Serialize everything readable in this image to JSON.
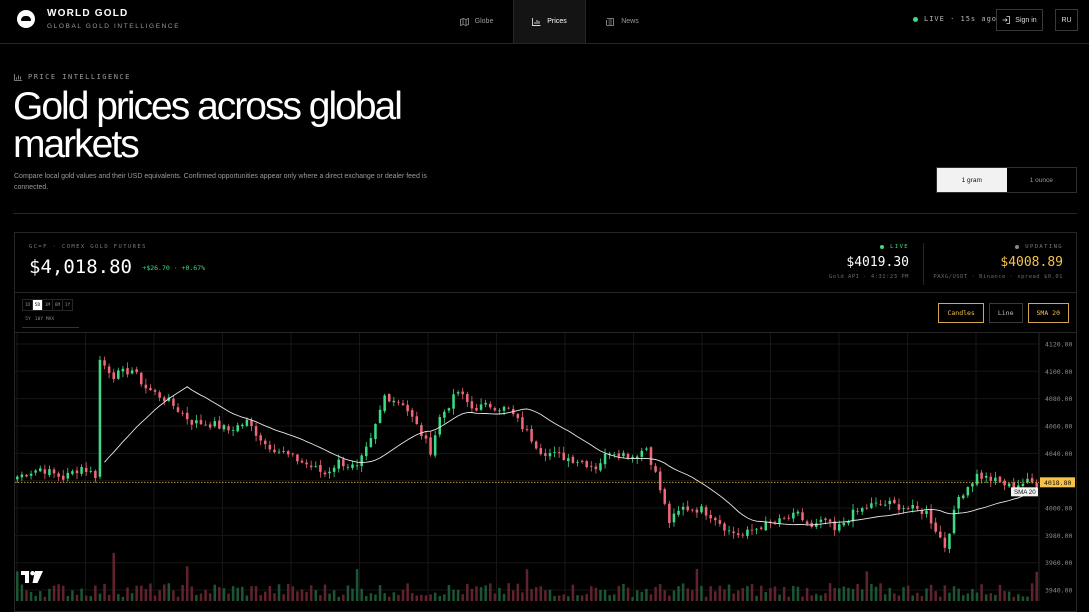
{
  "header": {
    "brand_title": "WORLD GOLD",
    "brand_subtitle": "GLOBAL GOLD INTELLIGENCE",
    "nav": [
      {
        "label": "Globe",
        "icon": "map-icon",
        "active": false
      },
      {
        "label": "Prices",
        "icon": "bar-chart-icon",
        "active": true
      },
      {
        "label": "News",
        "icon": "newspaper-icon",
        "active": false
      }
    ],
    "live_status": "LIVE · 15s ago",
    "sign_in": "Sign in",
    "language": "RU"
  },
  "hero": {
    "eyebrow": "PRICE INTELLIGENCE",
    "title": "Gold prices across global markets",
    "description": "Compare local gold values and their USD equivalents. Confirmed opportunities appear only where a direct exchange or dealer feed is connected.",
    "units": [
      {
        "label": "1 gram",
        "active": true
      },
      {
        "label": "1 ounce",
        "active": false
      }
    ]
  },
  "quote": {
    "label": "GC=F · COMEX GOLD FUTURES",
    "price": "$4,018.80",
    "change": "+$26.70 · +0.67%"
  },
  "feeds": [
    {
      "status": "LIVE",
      "price": "$4019.30",
      "meta": "Gold API · 4:31:23 PM",
      "status_color": "#3ddc84"
    },
    {
      "status": "UPDATING",
      "price": "$4008.89",
      "meta": "PAXG/USDT · Binance · spread $0.01",
      "status_color": "#8a8a8a"
    }
  ],
  "ranges": {
    "row1": [
      {
        "label": "1D",
        "active": false
      },
      {
        "label": "5D",
        "active": true
      },
      {
        "label": "1M",
        "active": false
      },
      {
        "label": "6M",
        "active": false
      },
      {
        "label": "1Y",
        "active": false
      }
    ],
    "row2": [
      {
        "label": "5Y",
        "active": false
      },
      {
        "label": "10Y",
        "active": false
      },
      {
        "label": "MAX",
        "active": false
      }
    ]
  },
  "chart_styles": [
    {
      "label": "Candles",
      "on": true
    },
    {
      "label": "Line",
      "on": false
    },
    {
      "label": "SMA 20",
      "on": true
    }
  ],
  "chart_data": {
    "type": "candlestick",
    "y_ticks": [
      4120,
      4100,
      4080,
      4060,
      4040,
      4020,
      4000,
      3980,
      3960,
      3940
    ],
    "ylim": [
      3932,
      4128
    ],
    "last_price": 4018.8,
    "last_price_label": "4018.80",
    "sma_label": "SMA 20",
    "anchors": [
      [
        0,
        4023
      ],
      [
        5,
        4029
      ],
      [
        10,
        4022
      ],
      [
        14,
        4030
      ],
      [
        17,
        4024
      ],
      [
        18,
        4108
      ],
      [
        21,
        4097
      ],
      [
        25,
        4101
      ],
      [
        28,
        4088
      ],
      [
        33,
        4078
      ],
      [
        38,
        4063
      ],
      [
        43,
        4061
      ],
      [
        46,
        4057
      ],
      [
        50,
        4063
      ],
      [
        54,
        4047
      ],
      [
        58,
        4040
      ],
      [
        63,
        4032
      ],
      [
        67,
        4025
      ],
      [
        70,
        4034
      ],
      [
        74,
        4029
      ],
      [
        77,
        4049
      ],
      [
        80,
        4082
      ],
      [
        84,
        4077
      ],
      [
        87,
        4060
      ],
      [
        90,
        4042
      ],
      [
        92,
        4066
      ],
      [
        96,
        4085
      ],
      [
        99,
        4073
      ],
      [
        103,
        4075
      ],
      [
        107,
        4072
      ],
      [
        111,
        4055
      ],
      [
        114,
        4042
      ],
      [
        118,
        4038
      ],
      [
        122,
        4035
      ],
      [
        126,
        4030
      ],
      [
        129,
        4042
      ],
      [
        134,
        4038
      ],
      [
        137,
        4044
      ],
      [
        139,
        4025
      ],
      [
        142,
        3990
      ],
      [
        145,
        4000
      ],
      [
        149,
        3999
      ],
      [
        152,
        3993
      ],
      [
        155,
        3983
      ],
      [
        158,
        3980
      ],
      [
        162,
        3987
      ],
      [
        166,
        3990
      ],
      [
        170,
        3995
      ],
      [
        173,
        3985
      ],
      [
        176,
        3991
      ],
      [
        178,
        3983
      ],
      [
        182,
        3996
      ],
      [
        186,
        4002
      ],
      [
        190,
        4003
      ],
      [
        194,
        4000
      ],
      [
        198,
        3997
      ],
      [
        202,
        3972
      ],
      [
        205,
        4008
      ],
      [
        209,
        4024
      ],
      [
        212,
        4021
      ],
      [
        216,
        4016
      ],
      [
        220,
        4019
      ],
      [
        222,
        4018
      ]
    ]
  }
}
